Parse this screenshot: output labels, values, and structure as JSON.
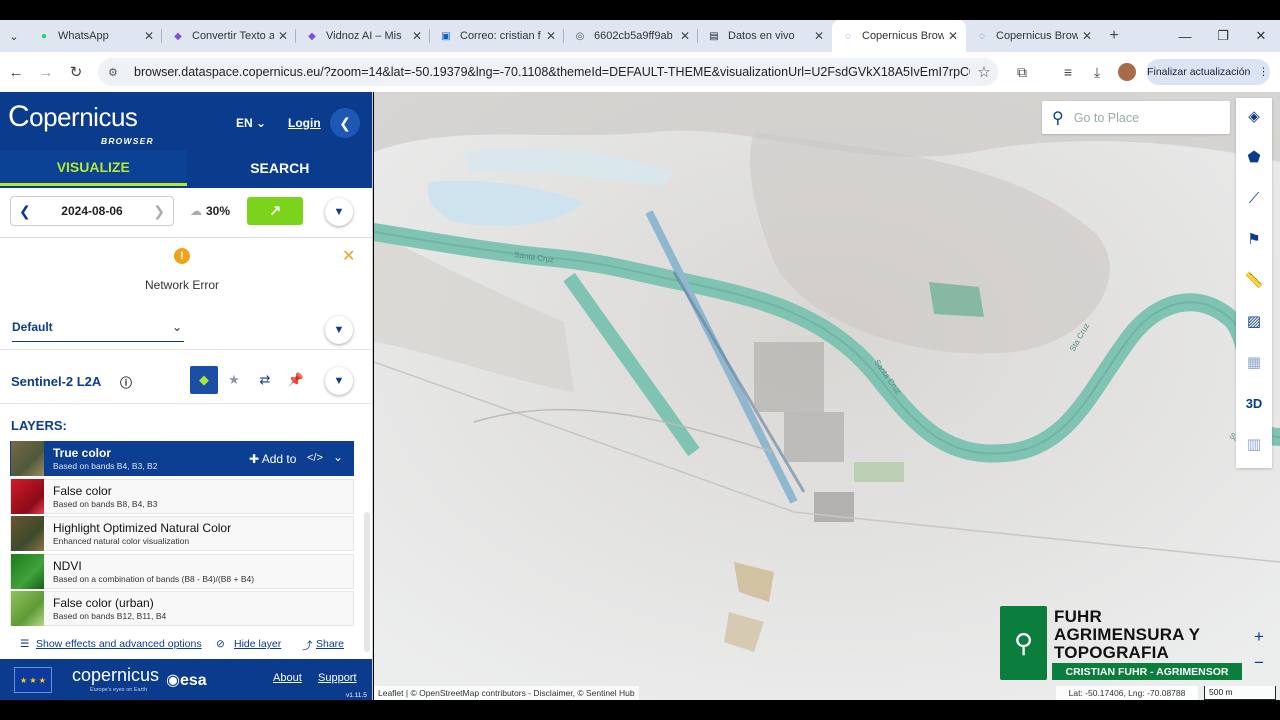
{
  "browser": {
    "tabs": [
      {
        "title": "WhatsApp",
        "icon": "whatsapp-icon",
        "active": false
      },
      {
        "title": "Convertir Texto a",
        "icon": "vidnoz-icon",
        "active": false
      },
      {
        "title": "Vidnoz AI – Mis ",
        "icon": "vidnoz-icon",
        "active": false
      },
      {
        "title": "Correo: cristian f",
        "icon": "outlook-icon",
        "active": false
      },
      {
        "title": "6602cb5a9ff9ab",
        "icon": "globe-icon",
        "active": false
      },
      {
        "title": "Datos en vivo",
        "icon": "doc-icon",
        "active": false
      },
      {
        "title": "Copernicus Brow",
        "icon": "loading-icon",
        "active": true
      },
      {
        "title": "Copernicus Brow",
        "icon": "loading-icon",
        "active": false
      }
    ],
    "url": "browser.dataspace.copernicus.eu/?zoom=14&lat=-50.19379&lng=-70.1108&themeId=DEFAULT-THEME&visualizationUrl=U2FsdGVkX18A5IvEmI7rpC0xuZQrhiA...",
    "update_button": "Finalizar actualización"
  },
  "panel": {
    "logo_text": "opernicus",
    "logo_sub": "BROWSER",
    "language": "EN",
    "login": "Login",
    "tab_visualize": "VISUALIZE",
    "tab_search": "SEARCH",
    "date": "2024-08-06",
    "cloud_cover": "30%",
    "error_message": "Network Error",
    "theme": "Default",
    "collection": "Sentinel-2 L2A",
    "layers_header": "LAYERS:",
    "add_to": "Add to",
    "layers": [
      {
        "name": "True color",
        "desc": "Based on bands B4, B3, B2",
        "selected": true,
        "color": "#6b5a3b"
      },
      {
        "name": "False color",
        "desc": "Based on bands B8, B4, B3",
        "selected": false,
        "color": "#c8102e"
      },
      {
        "name": "Highlight Optimized Natural Color",
        "desc": "Enhanced natural color visualization",
        "selected": false,
        "color": "#5a4a2a"
      },
      {
        "name": "NDVI",
        "desc": "Based on a combination of bands (B8 - B4)/(B8 + B4)",
        "selected": false,
        "color": "#2e8b24"
      },
      {
        "name": "False color (urban)",
        "desc": "Based on bands B12, B11, B4",
        "selected": false,
        "color": "#6fa83a"
      }
    ],
    "effects_link": "Show effects and advanced options",
    "hide_layer": "Hide layer",
    "share": "Share",
    "footer_logo": "copernicus",
    "footer_tagline": "Europe's eyes on Earth",
    "esa": "esa",
    "about": "About",
    "support": "Support",
    "version": "v1.11.5"
  },
  "map": {
    "search_placeholder": "Go to Place",
    "river_labels": [
      "Santa Cruz",
      "Santa Cruz",
      "Sta Cruz",
      "Santa Cruz"
    ],
    "attribution": "Leaflet | © OpenStreetMap contributors - Disclaimer, © Sentinel Hub",
    "coords": "Lat: -50.17406, Lng: -70.08788",
    "scale": "500 m",
    "tools": [
      "layers-icon",
      "polygon-icon",
      "line-icon",
      "pin-icon",
      "ruler-icon",
      "image-download-icon",
      "film-icon",
      "3D",
      "chart-icon"
    ],
    "watermark": {
      "line1": "FUHR",
      "line2": "AGRIMENSURA Y",
      "line3": "TOPOGRAFIA",
      "band": "CRISTIAN FUHR - AGRIMENSOR"
    }
  },
  "colors": {
    "brand": "#0b3b8c",
    "accent": "#b8ea2a",
    "go": "#7bd41b",
    "river": "#7fc3b3",
    "warning": "#f3a11b"
  }
}
